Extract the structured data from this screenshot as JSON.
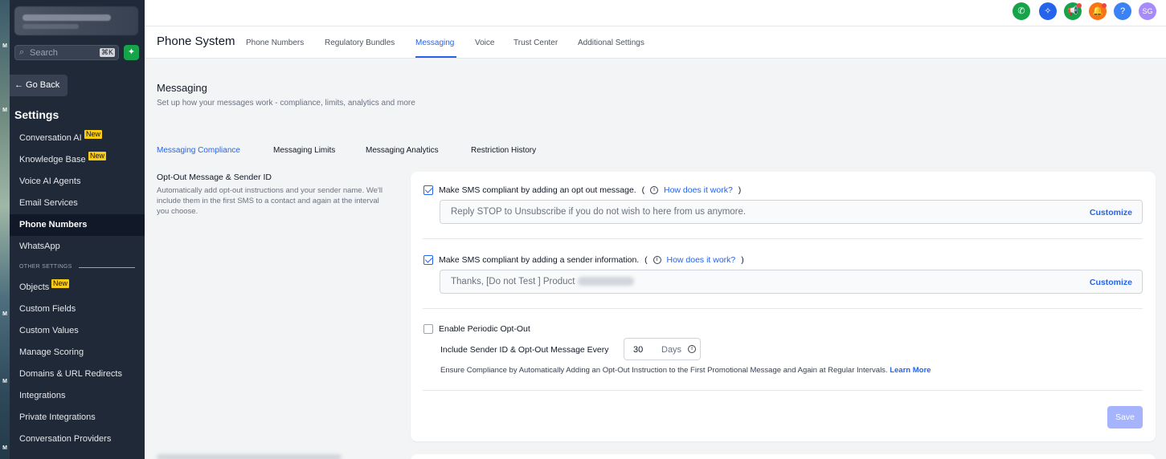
{
  "sidebar": {
    "search_placeholder": "Search",
    "search_shortcut": "⌘K",
    "go_back": "← Go Back",
    "title": "Settings",
    "items_top": [
      {
        "label": "Conversation AI",
        "badge": "New"
      },
      {
        "label": "Knowledge Base",
        "badge": "New"
      },
      {
        "label": "Voice AI Agents"
      },
      {
        "label": "Email Services"
      },
      {
        "label": "Phone Numbers",
        "active": true
      },
      {
        "label": "WhatsApp"
      }
    ],
    "section_label": "OTHER SETTINGS",
    "items_bottom": [
      {
        "label": "Objects",
        "badge": "New"
      },
      {
        "label": "Custom Fields"
      },
      {
        "label": "Custom Values"
      },
      {
        "label": "Manage Scoring"
      },
      {
        "label": "Domains & URL Redirects"
      },
      {
        "label": "Integrations"
      },
      {
        "label": "Private Integrations"
      },
      {
        "label": "Conversation Providers"
      }
    ]
  },
  "topbar": {
    "avatar_initials": "SG",
    "help_label": "?",
    "icon_colors": {
      "phone": "#16a34a",
      "sparkle": "#2563eb",
      "megaphone": "#16a34a",
      "bell": "#f97316",
      "help": "#3b82f6",
      "avatar": "#a78bfa"
    }
  },
  "header": {
    "title": "Phone System",
    "tabs": [
      "Phone Numbers",
      "Regulatory Bundles",
      "Messaging",
      "Voice",
      "Trust Center",
      "Additional Settings"
    ],
    "active_tab": "Messaging"
  },
  "main": {
    "title": "Messaging",
    "subtitle": "Set up how your messages work - compliance, limits, analytics and more",
    "subtabs": [
      "Messaging Compliance",
      "Messaging Limits",
      "Messaging Analytics",
      "Restriction History"
    ],
    "active_subtab": "Messaging Compliance",
    "section_heading": "Opt-Out Message & Sender ID",
    "section_desc": "Automatically add opt-out instructions and your sender name. We'll include them in the first SMS to a contact and again at the interval you choose."
  },
  "compliance": {
    "optout": {
      "checked": true,
      "label": "Make SMS compliant by adding an opt out message.",
      "paren_open": "(",
      "paren_close": ")",
      "how_link": "How does it work?",
      "value": "Reply STOP to Unsubscribe if you do not wish to here from us anymore.",
      "customize": "Customize"
    },
    "sender": {
      "checked": true,
      "label": "Make SMS compliant by adding a sender information.",
      "paren_open": "(",
      "paren_close": ")",
      "how_link": "How does it work?",
      "value": "Thanks, [Do not Test ] Product",
      "customize": "Customize"
    },
    "periodic": {
      "checked": false,
      "label": "Enable Periodic Opt-Out",
      "interval_label": "Include Sender ID & Opt-Out Message Every",
      "interval_value": "30",
      "interval_unit": "Days",
      "note": "Ensure Compliance by Automatically Adding an Opt-Out Instruction to the First Promotional Message and Again at Regular Intervals.",
      "learn_more": "Learn More"
    },
    "save": "Save"
  }
}
